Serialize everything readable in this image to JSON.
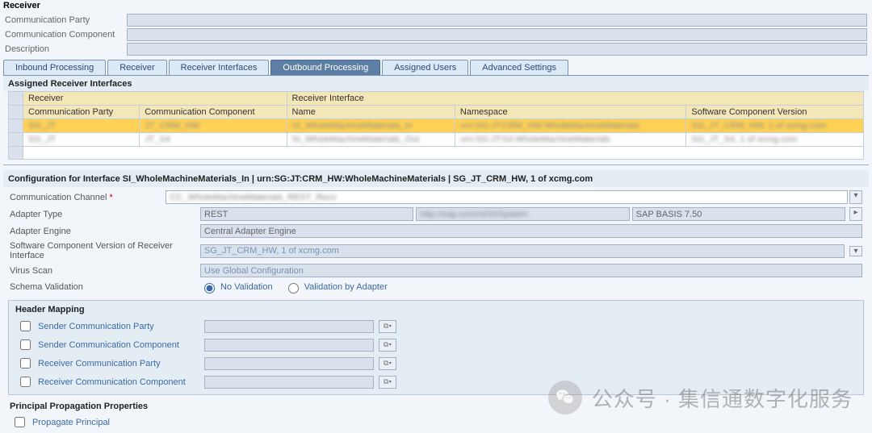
{
  "receiver_section": {
    "title": "Receiver",
    "fields": {
      "comm_party_label": "Communication Party",
      "comm_comp_label": "Communication Component",
      "desc_label": "Description"
    }
  },
  "tabs": {
    "inbound": "Inbound Processing",
    "receiver": "Receiver",
    "receiver_if": "Receiver Interfaces",
    "outbound": "Outbound Processing",
    "assigned_users": "Assigned Users",
    "advanced": "Advanced Settings"
  },
  "assigned_title": "Assigned Receiver Interfaces",
  "grid": {
    "super_receiver": "Receiver",
    "super_interface": "Receiver Interface",
    "cols": {
      "comm_party": "Communication Party",
      "comm_comp": "Communication Component",
      "name": "Name",
      "ns": "Namespace",
      "swcv": "Software Component Version"
    },
    "rows": [
      {
        "party": "SG_JT",
        "comp": "JT_CRM_HW",
        "name": "SI_WholeMachineMaterials_In",
        "ns": "urn:SG:JT:CRM_HW:WholeMachineMaterials",
        "swcv": "SG_JT_CRM_HW, 1 of xcmg.com"
      },
      {
        "party": "SG_JT",
        "comp": "JT_S4",
        "name": "SI_WholeMachineMaterials_Out",
        "ns": "urn:SG:JT:S4:WholeMachineMaterials",
        "swcv": "SG_JT_S4, 1 of xcmg.com"
      }
    ]
  },
  "cfg_title": "Configuration for Interface SI_WholeMachineMaterials_In | urn:SG:JT:CRM_HW:WholeMachineMaterials | SG_JT_CRM_HW, 1 of xcmg.com",
  "cfg": {
    "comm_channel_label": "Communication Channel",
    "comm_channel_value": "CC_WholeMachineMaterials_REST_Recv",
    "adapter_type_label": "Adapter Type",
    "adapter_type_value": "REST",
    "adapter_type_ns": "http://sap.com/xi/XI/System",
    "adapter_type_swcv": "SAP BASIS 7.50",
    "adapter_engine_label": "Adapter Engine",
    "adapter_engine_value": "Central Adapter Engine",
    "swcv_recv_label": "Software Component Version of Receiver Interface",
    "swcv_recv_value": "SG_JT_CRM_HW, 1 of xcmg.com",
    "virus_label": "Virus Scan",
    "virus_value": "Use Global Configuration",
    "schema_label": "Schema Validation",
    "schema_opt1": "No Validation",
    "schema_opt2": "Validation by Adapter"
  },
  "header_mapping": {
    "title": "Header Mapping",
    "sender_party": "Sender Communication Party",
    "sender_comp": "Sender Communication Component",
    "receiver_party": "Receiver Communication Party",
    "receiver_comp": "Receiver Communication Component"
  },
  "principal": {
    "title": "Principal Propagation Properties",
    "propagate": "Propagate Principal"
  },
  "watermark": "公众号 · 集信通数字化服务"
}
